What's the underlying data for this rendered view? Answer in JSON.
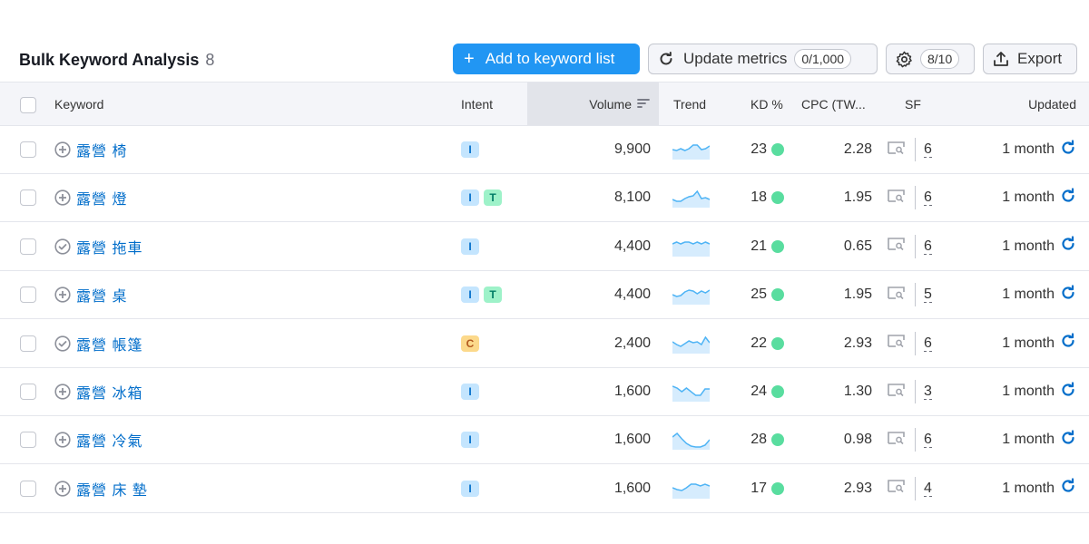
{
  "header": {
    "title": "Bulk Keyword Analysis",
    "count": "8",
    "add_button": "Add to keyword list",
    "update_button": "Update metrics",
    "update_quota": "0/1,000",
    "settings_quota": "8/10",
    "export_button": "Export"
  },
  "columns": {
    "keyword": "Keyword",
    "intent": "Intent",
    "volume": "Volume",
    "trend": "Trend",
    "kd": "KD %",
    "cpc": "CPC (TW...",
    "sf": "SF",
    "updated": "Updated"
  },
  "colors": {
    "primary": "#2196f3",
    "link": "#006dca",
    "kd_easy": "#59dd9f",
    "trend_line": "#4fb4f5",
    "trend_fill": "#d6ecfd"
  },
  "rows": [
    {
      "keyword": "露營 椅",
      "status": "add",
      "intents": [
        "I"
      ],
      "volume": "9,900",
      "trend": [
        0.55,
        0.5,
        0.6,
        0.5,
        0.6,
        0.8,
        0.8,
        0.55,
        0.6,
        0.75
      ],
      "kd": "23",
      "cpc": "2.28",
      "sf": "6",
      "updated": "1 month"
    },
    {
      "keyword": "露營 燈",
      "status": "add",
      "intents": [
        "I",
        "T"
      ],
      "volume": "8,100",
      "trend": [
        0.45,
        0.35,
        0.35,
        0.5,
        0.6,
        0.65,
        0.9,
        0.5,
        0.55,
        0.45
      ],
      "kd": "18",
      "cpc": "1.95",
      "sf": "6",
      "updated": "1 month"
    },
    {
      "keyword": "露營 拖車",
      "status": "added",
      "intents": [
        "I"
      ],
      "volume": "4,400",
      "trend": [
        0.7,
        0.8,
        0.7,
        0.8,
        0.8,
        0.7,
        0.8,
        0.7,
        0.8,
        0.7
      ],
      "kd": "21",
      "cpc": "0.65",
      "sf": "6",
      "updated": "1 month"
    },
    {
      "keyword": "露營 桌",
      "status": "add",
      "intents": [
        "I",
        "T"
      ],
      "volume": "4,400",
      "trend": [
        0.55,
        0.45,
        0.5,
        0.7,
        0.8,
        0.75,
        0.6,
        0.75,
        0.65,
        0.8
      ],
      "kd": "25",
      "cpc": "1.95",
      "sf": "5",
      "updated": "1 month"
    },
    {
      "keyword": "露營 帳篷",
      "status": "added",
      "intents": [
        "C"
      ],
      "volume": "2,400",
      "trend": [
        0.65,
        0.5,
        0.4,
        0.55,
        0.7,
        0.6,
        0.65,
        0.5,
        0.9,
        0.6
      ],
      "kd": "22",
      "cpc": "2.93",
      "sf": "6",
      "updated": "1 month"
    },
    {
      "keyword": "露營 冰箱",
      "status": "add",
      "intents": [
        "I"
      ],
      "volume": "1,600",
      "trend": [
        0.85,
        0.75,
        0.55,
        0.75,
        0.55,
        0.35,
        0.35,
        0.7,
        0.7
      ],
      "kd": "24",
      "cpc": "1.30",
      "sf": "3",
      "updated": "1 month"
    },
    {
      "keyword": "露營 冷氣",
      "status": "add",
      "intents": [
        "I"
      ],
      "volume": "1,600",
      "trend": [
        0.7,
        0.9,
        0.6,
        0.35,
        0.2,
        0.15,
        0.15,
        0.25,
        0.55
      ],
      "kd": "28",
      "cpc": "0.98",
      "sf": "6",
      "updated": "1 month"
    },
    {
      "keyword": "露營 床 墊",
      "status": "add",
      "intents": [
        "I"
      ],
      "volume": "1,600",
      "trend": [
        0.6,
        0.5,
        0.45,
        0.6,
        0.8,
        0.8,
        0.7,
        0.8,
        0.7
      ],
      "kd": "17",
      "cpc": "2.93",
      "sf": "4",
      "updated": "1 month"
    }
  ]
}
